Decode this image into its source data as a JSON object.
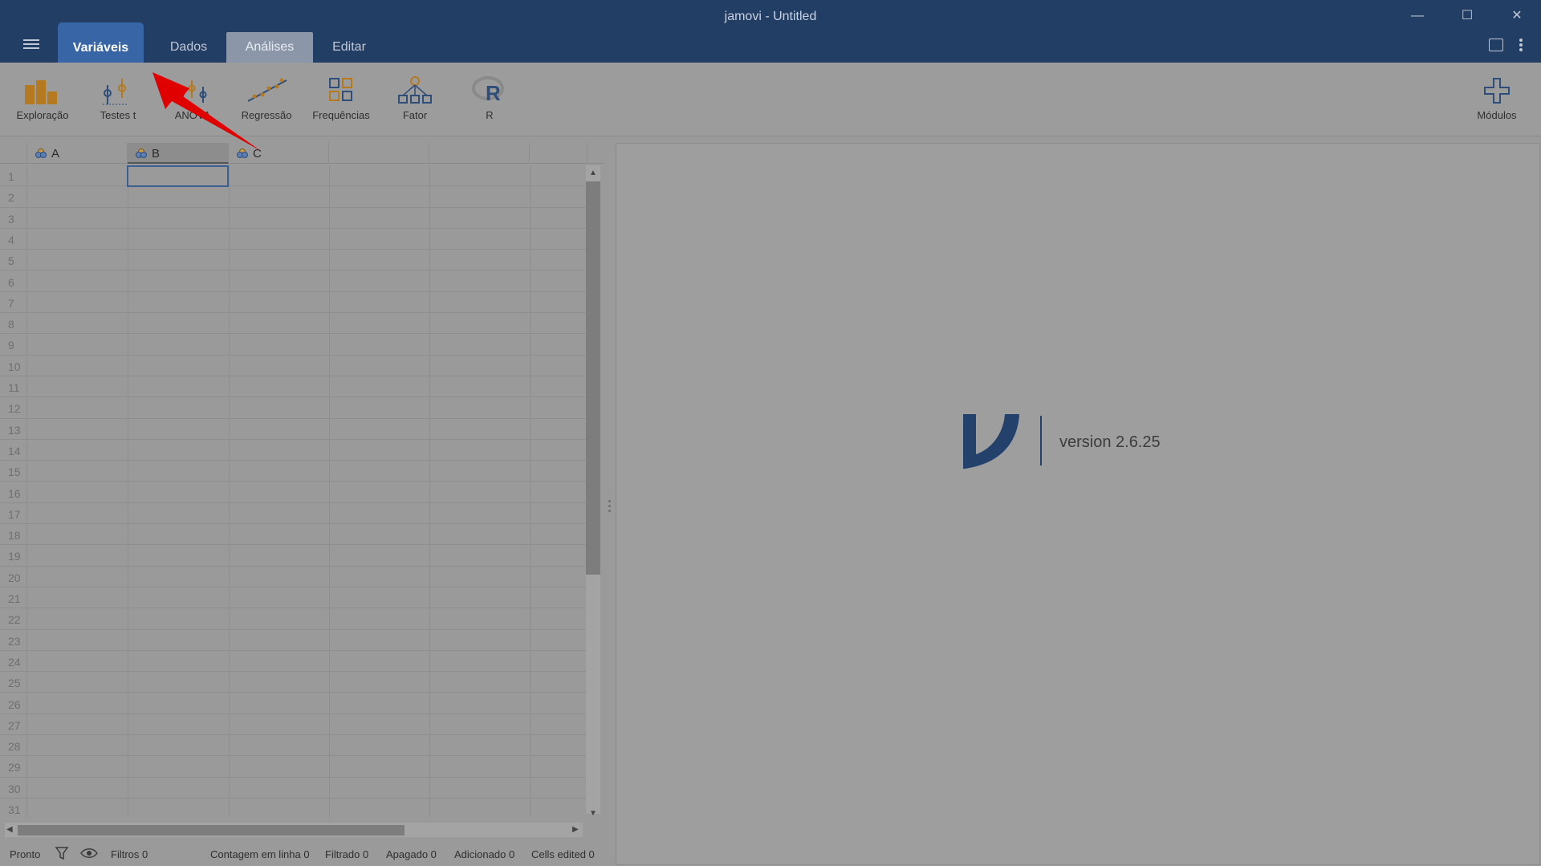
{
  "window": {
    "title": "jamovi - Untitled",
    "minimize": "—",
    "maximize": "☐",
    "close": "✕"
  },
  "tabs": [
    {
      "label": "Variáveis",
      "state": "highlighted"
    },
    {
      "label": "Dados"
    },
    {
      "label": "Análises",
      "state": "active"
    },
    {
      "label": "Editar"
    }
  ],
  "ribbon": {
    "buttons": [
      {
        "label": "Exploração",
        "icon": "bar-chart-icon"
      },
      {
        "label": "Testes t",
        "icon": "t-test-icon"
      },
      {
        "label": "ANOVA",
        "icon": "anova-icon"
      },
      {
        "label": "Regressão",
        "icon": "regression-icon"
      },
      {
        "label": "Frequências",
        "icon": "frequencies-icon"
      },
      {
        "label": "Fator",
        "icon": "factor-icon"
      },
      {
        "label": "R",
        "icon": "r-icon"
      }
    ],
    "modules": {
      "label": "Módulos",
      "icon": "plus-icon"
    }
  },
  "sheet": {
    "columns": [
      "A",
      "B",
      "C"
    ],
    "row_numbers": [
      "1",
      "2",
      "3",
      "4",
      "5",
      "6",
      "7",
      "8",
      "9",
      "10",
      "11",
      "12",
      "13",
      "14",
      "15",
      "16",
      "17",
      "18",
      "19",
      "20",
      "21",
      "22",
      "23",
      "24",
      "25",
      "26",
      "27",
      "28",
      "29",
      "30",
      "31"
    ]
  },
  "results": {
    "version": "version 2.6.25"
  },
  "status": {
    "ready": "Pronto",
    "filters": "Filtros 0",
    "row_count": "Contagem em linha 0",
    "filtered": "Filtrado 0",
    "deleted": "Apagado 0",
    "added": "Adicionado 0",
    "cells_edited": "Cells edited 0"
  },
  "colors": {
    "titlebar": "#233e64",
    "highlight_tab": "#3765a6",
    "annotation_arrow": "#e00000",
    "logo": "#23416b"
  }
}
